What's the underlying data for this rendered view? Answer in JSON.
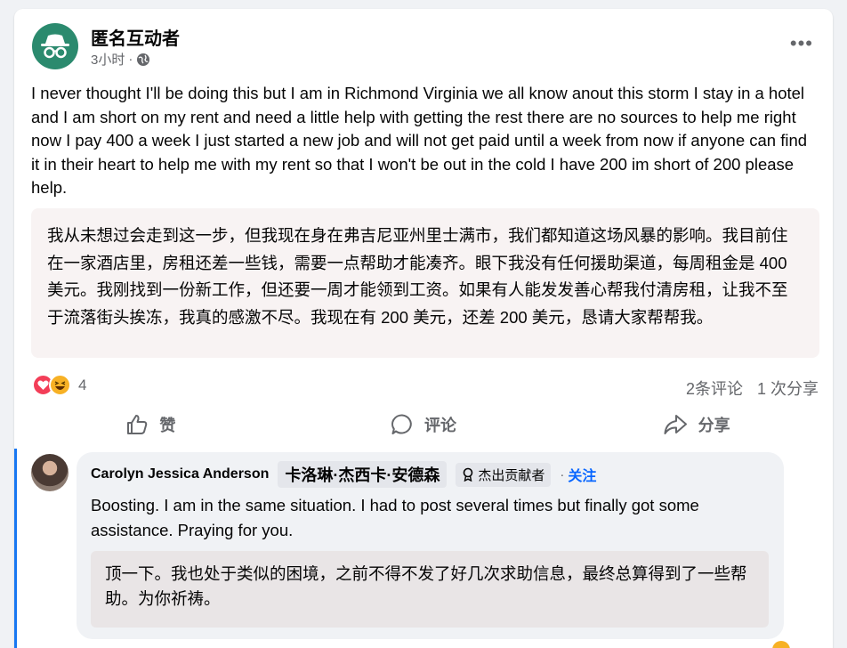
{
  "post": {
    "author": "匿名互动者",
    "time": "3小时",
    "separator": "·",
    "more_label": "•••",
    "body": "I never thought I'll be doing this but I am in Richmond Virginia we all know anout this storm I stay in a hotel and I am short on my rent and need a little help with getting the rest there are no sources to help me right now I pay 400 a week I just started a new job and will not get paid until a week from now if anyone can find it in their heart to help me with my rent so that I won't be out in the cold I have 200 im short of 200 please help.",
    "translation": "我从未想过会走到这一步，但我现在身在弗吉尼亚州里士满市，我们都知道这场风暴的影响。我目前住在一家酒店里，房租还差一些钱，需要一点帮助才能凑齐。眼下我没有任何援助渠道，每周租金是 400 美元。我刚找到一份新工作，但还要一周才能领到工资。如果有人能发发善心帮我付清房租，让我不至于流落街头挨冻，我真的感激不尽。我现在有 200 美元，还差 200 美元，恳请大家帮帮我。",
    "reaction_count": "4",
    "comments_count": "2条评论",
    "shares_count": "1 次分享"
  },
  "actions": {
    "like": "赞",
    "comment": "评论",
    "share": "分享"
  },
  "comment": {
    "name": "Carolyn Jessica Anderson",
    "name_translated": "卡洛琳·杰西卡·安德森",
    "badge": "杰出贡献者",
    "dot": "·",
    "follow": "关注",
    "text": "Boosting. I am in the same situation. I had to post several times but finally got some assistance. Praying for you.",
    "translation": "顶一下。我也处于类似的困境，之前不得不发了好几次求助信息，最终总算得到了一些帮助。为你祈祷。"
  },
  "icons": {
    "avatar": "incognito-icon",
    "privacy": "globe-icon",
    "like": "thumbs-up-icon",
    "comment": "speech-bubble-icon",
    "share": "share-arrow-icon",
    "badge": "contributor-medal-icon"
  },
  "colors": {
    "accent": "#0866ff",
    "avatar_bg": "#2b8a6e",
    "love": "#f33e58",
    "haha": "#f7b125",
    "muted": "#65676b"
  }
}
